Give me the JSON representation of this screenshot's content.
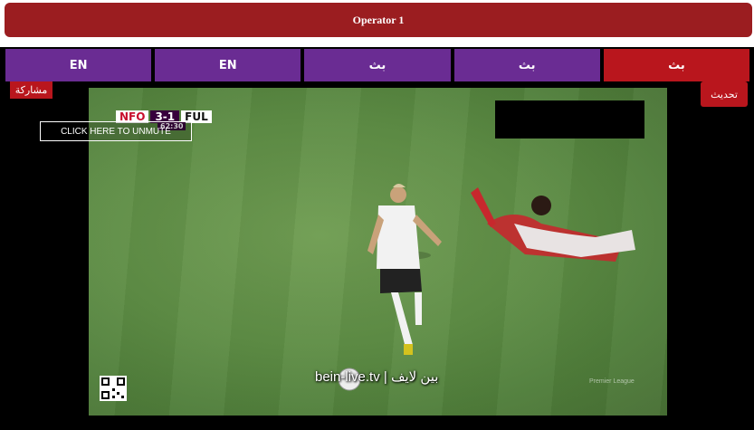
{
  "header": {
    "title": "Operator 1"
  },
  "tabs": [
    {
      "label": "EN",
      "active": false
    },
    {
      "label": "EN",
      "active": false
    },
    {
      "label": "بث",
      "active": false
    },
    {
      "label": "بث",
      "active": false
    },
    {
      "label": "بث",
      "active": true
    }
  ],
  "actions": {
    "share_label": "مشاركة",
    "refresh_label": "تحديث"
  },
  "player": {
    "unmute_label": "CLICK HERE TO UNMUTE",
    "watermark": "bein-live.tv | بين لايف",
    "scoreboard": {
      "home": "NFO",
      "score": "3-1",
      "away": "FUL",
      "time": "62:30"
    },
    "competition_logo": "Premier League"
  },
  "colors": {
    "header_red": "#9b1d20",
    "tab_purple": "#6a2c93",
    "tab_active_red": "#b9161d",
    "pitch_green": "#5e8d45"
  }
}
